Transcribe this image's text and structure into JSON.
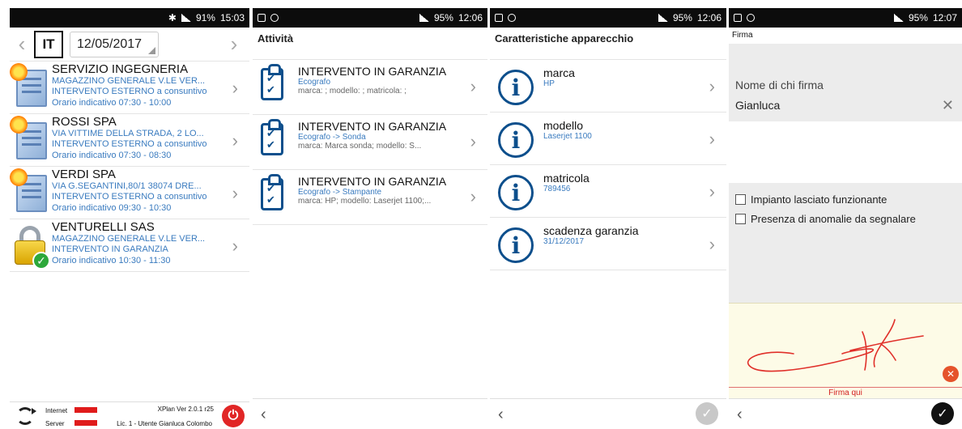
{
  "panel1": {
    "status": {
      "bt": "✱",
      "signal": "ᯤ",
      "battery": "91%",
      "time": "15:03"
    },
    "lang": "IT",
    "date": "12/05/2017",
    "appointments": [
      {
        "name": "SERVIZIO INGEGNERIA",
        "address": "MAGAZZINO GENERALE V.LE VER...",
        "type": "INTERVENTO ESTERNO a consuntivo",
        "time": "Orario indicativo 07:30 - 10:00",
        "icon": "document-icon"
      },
      {
        "name": "ROSSI SPA",
        "address": "VIA VITTIME DELLA STRADA, 2 LO...",
        "type": "INTERVENTO ESTERNO a consuntivo",
        "time": "Orario indicativo 07:30 - 08:30",
        "icon": "document-icon"
      },
      {
        "name": "VERDI SPA",
        "address": "VIA G.SEGANTINI,80/1 38074 DRE...",
        "type": "INTERVENTO ESTERNO a consuntivo",
        "time": "Orario indicativo 09:30 - 10:30",
        "icon": "document-icon"
      },
      {
        "name": "VENTURELLI SAS",
        "address": "MAGAZZINO GENERALE V.LE VER...",
        "type": "INTERVENTO IN GARANZIA",
        "time": "Orario indicativo 10:30 - 11:30",
        "icon": "lock-icon"
      }
    ],
    "footer": {
      "internet": "Internet",
      "server": "Server",
      "version": "XPlan Ver 2.0.1 r25",
      "license": "Lic. 1 - Utente Gianluca Colombo",
      "flag_color": "#e01b1b"
    }
  },
  "panel2": {
    "status": {
      "battery": "95%",
      "time": "12:06"
    },
    "title": "Attività",
    "activities": [
      {
        "title": "INTERVENTO IN GARANZIA",
        "device": "Ecografo",
        "details": "marca: ; modello: ; matricola: ;"
      },
      {
        "title": "INTERVENTO IN GARANZIA",
        "device": "Ecografo -> Sonda",
        "details": "marca: Marca sonda; modello: S..."
      },
      {
        "title": "INTERVENTO IN GARANZIA",
        "device": "Ecografo -> Stampante",
        "details": "marca: HP; modello: Laserjet 1100;..."
      }
    ]
  },
  "panel3": {
    "status": {
      "battery": "95%",
      "time": "12:06"
    },
    "title": "Caratteristiche apparecchio",
    "fields": [
      {
        "label": "marca",
        "value": "HP"
      },
      {
        "label": "modello",
        "value": "Laserjet 1100"
      },
      {
        "label": "matricola",
        "value": "789456"
      },
      {
        "label": "scadenza garanzia",
        "value": "31/12/2017"
      }
    ]
  },
  "panel4": {
    "status": {
      "battery": "95%",
      "time": "12:07"
    },
    "title": "Firma",
    "signer_label": "Nome di chi firma",
    "signer_value": "Gianluca",
    "checks": [
      {
        "label": "Impianto lasciato funzionante"
      },
      {
        "label": "Presenza di anomalie da segnalare"
      }
    ],
    "sign_here": "Firma qui",
    "ink_color": "#e0302a"
  },
  "colors": {
    "accent_blue": "#0d4f8c",
    "link_blue": "#3a7bbf",
    "signature_bg": "#fdfbe7",
    "danger": "#e12626"
  }
}
